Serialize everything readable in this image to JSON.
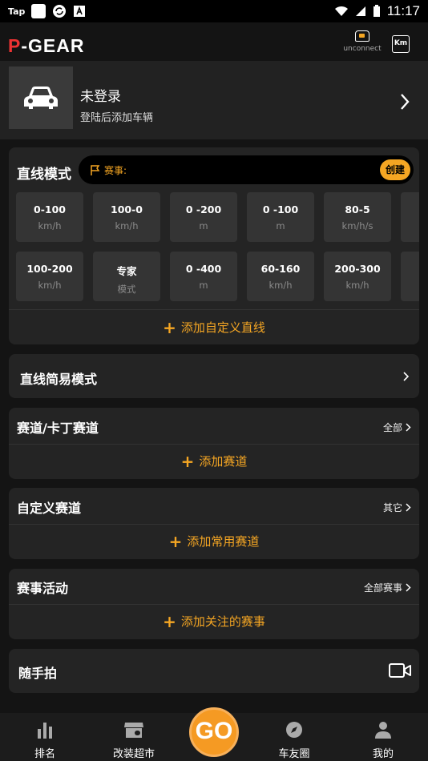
{
  "status_bar": {
    "app_label": "Tap",
    "time": "11:17"
  },
  "header": {
    "logo_p": "P",
    "logo_rest": "-GEAR",
    "unconnect_label": "unconnect",
    "km_label": "Km"
  },
  "user": {
    "name": "未登录",
    "subtitle": "登陆后添加车辆"
  },
  "straight_mode": {
    "title": "直线模式",
    "race_label": "赛事:",
    "create_label": "创建",
    "tiles_row1": [
      {
        "value": "0-100",
        "unit": "km/h"
      },
      {
        "value": "100-0",
        "unit": "km/h"
      },
      {
        "value": "0 -200",
        "unit": "m"
      },
      {
        "value": "0 -100",
        "unit": "m"
      },
      {
        "value": "80-5",
        "unit": "km/h/s"
      }
    ],
    "tiles_row2": [
      {
        "value": "100-200",
        "unit": "km/h"
      },
      {
        "value": "专家",
        "unit": "模式"
      },
      {
        "value": "0 -400",
        "unit": "m"
      },
      {
        "value": "60-160",
        "unit": "km/h"
      },
      {
        "value": "200-300",
        "unit": "km/h"
      }
    ],
    "add_label": "添加自定义直线"
  },
  "simple_mode": {
    "title": "直线简易模式"
  },
  "track": {
    "title": "赛道/卡丁赛道",
    "link": "全部",
    "add_label": "添加赛道"
  },
  "custom_track": {
    "title": "自定义赛道",
    "link": "其它",
    "add_label": "添加常用赛道"
  },
  "events": {
    "title": "赛事活动",
    "link": "全部赛事",
    "add_label": "添加关注的赛事"
  },
  "snapshot": {
    "title": "随手拍"
  },
  "bottom_nav": {
    "items": [
      {
        "label": "排名",
        "icon": "bar-chart-icon"
      },
      {
        "label": "改装超市",
        "icon": "store-icon"
      },
      {
        "label": "车友圈",
        "icon": "compass-icon"
      },
      {
        "label": "我的",
        "icon": "user-icon"
      }
    ],
    "go_label": "GO"
  },
  "colors": {
    "accent": "#f5a623",
    "background": "#141414",
    "card": "#242424",
    "logo_red": "#e33333"
  }
}
